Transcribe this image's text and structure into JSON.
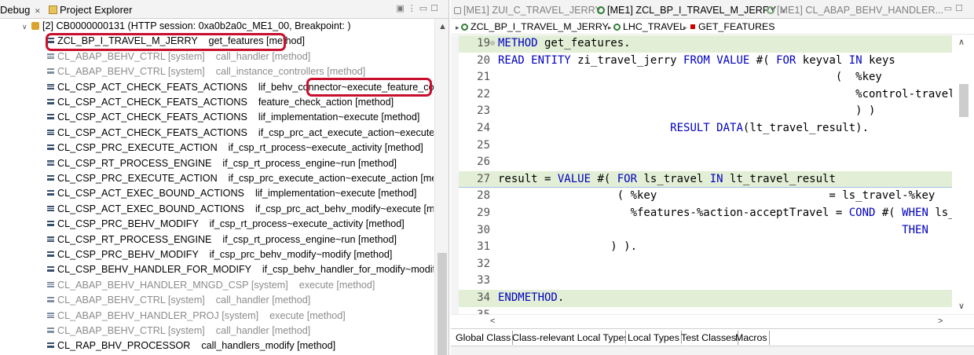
{
  "left_tabs": {
    "debug": "Debug",
    "debug_close": "✕",
    "project_explorer": "Project Explorer"
  },
  "tree": {
    "thread": "[2] CB0000000131 (HTTP session: 0xa0b2a0c_ME1_00, Breakpoint: )",
    "frames": [
      {
        "text": "ZCL_BP_I_TRAVEL_M_JERRY    get_features [method]",
        "system": false,
        "selected": true
      },
      {
        "text": "CL_ABAP_BEHV_CTRL [system]    call_handler [method]",
        "system": true
      },
      {
        "text": "CL_ABAP_BEHV_CTRL [system]    call_instance_controllers [method]",
        "system": true
      },
      {
        "text": "CL_CSP_ACT_CHECK_FEATS_ACTIONS    lif_behv_connector~execute_feature_controllers [",
        "system": false
      },
      {
        "text": "CL_CSP_ACT_CHECK_FEATS_ACTIONS    feature_check_action [method]",
        "system": false
      },
      {
        "text": "CL_CSP_ACT_CHECK_FEATS_ACTIONS    lif_implementation~execute [method]",
        "system": false
      },
      {
        "text": "CL_CSP_ACT_CHECK_FEATS_ACTIONS    if_csp_prc_act_execute_action~execute [method]",
        "system": false
      },
      {
        "text": "CL_CSP_PRC_EXECUTE_ACTION    if_csp_rt_process~execute_activity [method]",
        "system": false
      },
      {
        "text": "CL_CSP_RT_PROCESS_ENGINE    if_csp_rt_process_engine~run [method]",
        "system": false
      },
      {
        "text": "CL_CSP_PRC_EXECUTE_ACTION    if_csp_prc_execute_action~execute_action [method]",
        "system": false
      },
      {
        "text": "CL_CSP_ACT_EXEC_BOUND_ACTIONS    lif_implementation~execute [method]",
        "system": false
      },
      {
        "text": "CL_CSP_ACT_EXEC_BOUND_ACTIONS    if_csp_prc_act_behv_modify~execute [method]",
        "system": false
      },
      {
        "text": "CL_CSP_PRC_BEHV_MODIFY    if_csp_rt_process~execute_activity [method]",
        "system": false
      },
      {
        "text": "CL_CSP_RT_PROCESS_ENGINE    if_csp_rt_process_engine~run [method]",
        "system": false
      },
      {
        "text": "CL_CSP_PRC_BEHV_MODIFY    if_csp_prc_behv_modify~modify [method]",
        "system": false
      },
      {
        "text": "CL_CSP_BEHV_HANDLER_FOR_MODIFY    if_csp_behv_handler_for_modify~modify [meth",
        "system": false
      },
      {
        "text": "CL_ABAP_BEHV_HANDLER_MNGD_CSP [system]    execute [method]",
        "system": true
      },
      {
        "text": "CL_ABAP_BEHV_CTRL [system]    call_handler [method]",
        "system": true
      },
      {
        "text": "CL_ABAP_BEHV_HANDLER_PROJ [system]    execute [method]",
        "system": true
      },
      {
        "text": "CL_ABAP_BEHV_CTRL [system]    call_handler [method]",
        "system": true
      },
      {
        "text": "CL_RAP_BHV_PROCESSOR    call_handlers_modify [method]",
        "system": false
      }
    ]
  },
  "editor_tabs": [
    {
      "label": "[ME1] ZUI_C_TRAVEL_JERRY",
      "active": false
    },
    {
      "label": "[ME1] ZCL_BP_I_TRAVEL_M_JERRY",
      "active": true,
      "close": "✕"
    },
    {
      "label": "[ME1] CL_ABAP_BEHV_HANDLER...",
      "active": false
    }
  ],
  "breadcrumbs": [
    "ZCL_BP_I_TRAVEL_M_JERRY",
    "LHC_TRAVEL",
    "GET_FEATURES"
  ],
  "code_lines": [
    {
      "n": "19",
      "fold": "⊖",
      "text": "METHOD get_features.",
      "hl": true
    },
    {
      "n": "20",
      "text": "READ ENTITY zi_travel_jerry FROM VALUE #( FOR keyval IN keys",
      "hl": false
    },
    {
      "n": "21",
      "text": "                                                   (  %key",
      "hl": false
    },
    {
      "n": "22",
      "text": "                                                      %control-travel_",
      "hl": false
    },
    {
      "n": "23",
      "text": "                                                      ) )",
      "hl": false
    },
    {
      "n": "24",
      "text": "                          RESULT DATA(lt_travel_result).",
      "hl": false
    },
    {
      "n": "25",
      "text": "",
      "hl": false
    },
    {
      "n": "26",
      "text": "",
      "hl": false
    },
    {
      "n": "27",
      "text": "result = VALUE #( FOR ls_travel IN lt_travel_result",
      "hl": true,
      "cur": true
    },
    {
      "n": "28",
      "text": "                  ( %key                          = ls_travel-%key",
      "hl": false
    },
    {
      "n": "29",
      "text": "                    %features-%action-acceptTravel = COND #( WHEN ls_",
      "hl": false
    },
    {
      "n": "30",
      "text": "                                                             THEN ",
      "hl": false
    },
    {
      "n": "31",
      "text": "                 ) ).",
      "hl": false
    },
    {
      "n": "32",
      "text": "",
      "hl": false
    },
    {
      "n": "33",
      "text": "",
      "hl": false
    },
    {
      "n": "34",
      "text": "ENDMETHOD.",
      "hl": true
    },
    {
      "n": "35",
      "text": "",
      "hl": false
    }
  ],
  "bottom_tabs": [
    {
      "label": "Global Class",
      "active": false
    },
    {
      "label": "Class-relevant Local Types",
      "active": false
    },
    {
      "label": "Local Types",
      "active": true
    },
    {
      "label": "Test Classes",
      "active": false
    },
    {
      "label": "Macros",
      "active": false
    }
  ],
  "colors": {
    "highlight_box": "#c8102e",
    "keyword": "#0000c0",
    "line_highlight": "#e2efd6"
  }
}
